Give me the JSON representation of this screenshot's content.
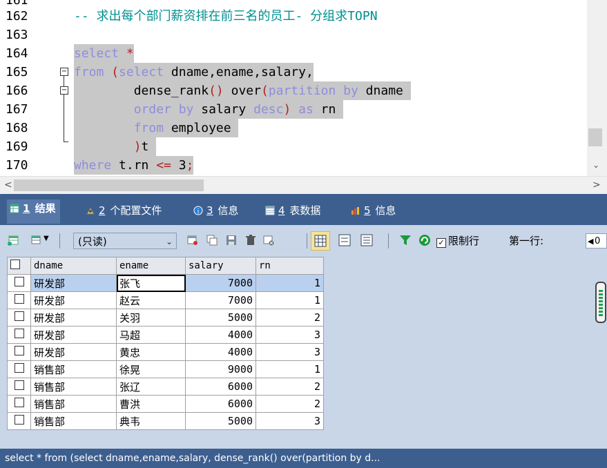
{
  "editor": {
    "lines": [
      {
        "num": "161",
        "text": ""
      },
      {
        "num": "162",
        "text": "-- 求出每个部门薪资排在前三名的员工- 分组求TOPN"
      },
      {
        "num": "163",
        "text": ""
      },
      {
        "num": "164",
        "text": "select *"
      },
      {
        "num": "165",
        "text": "from (select dname,ename,salary,"
      },
      {
        "num": "166",
        "text": "        dense_rank() over(partition by dname"
      },
      {
        "num": "167",
        "text": "        order by salary desc) as rn"
      },
      {
        "num": "168",
        "text": "        from employee"
      },
      {
        "num": "169",
        "text": "        )t"
      },
      {
        "num": "170",
        "text": "where t.rn <= 3;"
      }
    ]
  },
  "tabs": [
    {
      "num": "1",
      "label": "结果",
      "icon": "result-grid-icon",
      "active": true
    },
    {
      "num": "2",
      "label": "个配置文件",
      "icon": "profile-icon",
      "active": false
    },
    {
      "num": "3",
      "label": "信息",
      "icon": "info-icon",
      "active": false
    },
    {
      "num": "4",
      "label": "表数据",
      "icon": "table-data-icon",
      "active": false
    },
    {
      "num": "5",
      "label": "信息",
      "icon": "info-chart-icon",
      "active": false
    }
  ],
  "toolbar": {
    "readonly_select": "(只读)",
    "limit_rows_label": "限制行",
    "first_row_label": "第一行:",
    "first_row_value": "0"
  },
  "grid": {
    "columns": [
      "dname",
      "ename",
      "salary",
      "rn"
    ],
    "rows": [
      [
        "研发部",
        "张飞",
        "7000",
        "1"
      ],
      [
        "研发部",
        "赵云",
        "7000",
        "1"
      ],
      [
        "研发部",
        "关羽",
        "5000",
        "2"
      ],
      [
        "研发部",
        "马超",
        "4000",
        "3"
      ],
      [
        "研发部",
        "黄忠",
        "4000",
        "3"
      ],
      [
        "销售部",
        "徐晃",
        "9000",
        "1"
      ],
      [
        "销售部",
        "张辽",
        "6000",
        "2"
      ],
      [
        "销售部",
        "曹洪",
        "6000",
        "2"
      ],
      [
        "销售部",
        "典韦",
        "5000",
        "3"
      ]
    ]
  },
  "status": {
    "text": "select * from (select dname,ename,salary, dense_rank() over(partition by d..."
  },
  "colors": {
    "keyword": "#8d8de0",
    "comment": "#008f8f",
    "tab_bar": "#3d5f8f",
    "toolbar": "#c9d6e8",
    "selection": "#c8c8c8"
  }
}
